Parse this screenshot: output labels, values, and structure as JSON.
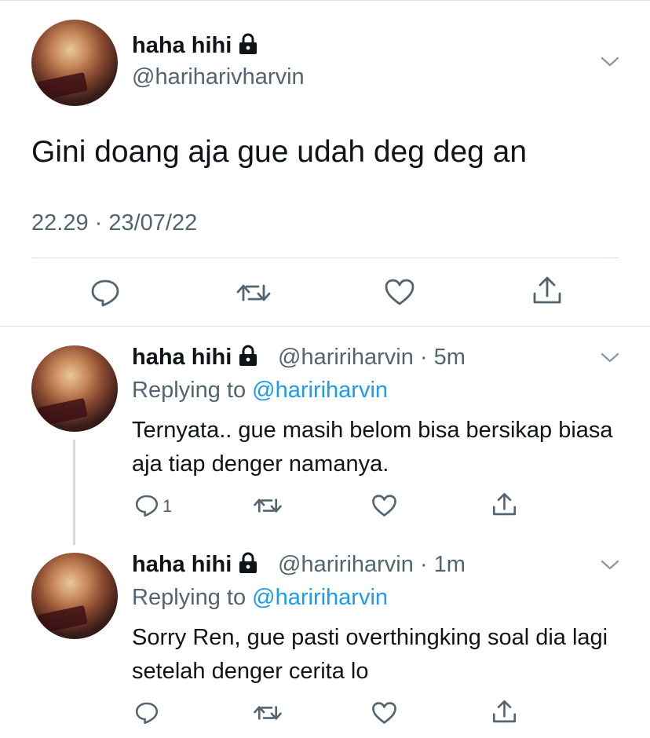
{
  "main_tweet": {
    "name": "haha hihi",
    "handle": "@hariharivharvin",
    "text": "Gini doang aja gue udah deg deg an",
    "timestamp": "22.29 · 23/07/22"
  },
  "replies": [
    {
      "name": "haha hihi",
      "handle": "@haririharvin",
      "time": "5m",
      "replying_label": "Replying to",
      "replying_handle": "@haririharvin",
      "text": "Ternyata.. gue masih belom bisa bersikap biasa aja tiap denger namanya.",
      "reply_count": "1"
    },
    {
      "name": "haha hihi",
      "handle": "@haririharvin",
      "time": "1m",
      "replying_label": "Replying to",
      "replying_handle": "@haririharvin",
      "text": "Sorry Ren, gue pasti overthingking soal dia lagi setelah denger cerita lo",
      "reply_count": ""
    }
  ],
  "icons": [
    "lock-icon",
    "chevron-down-icon",
    "reply-icon",
    "retweet-icon",
    "like-icon",
    "share-icon"
  ],
  "colors": {
    "text": "#0f1419",
    "muted": "#536471",
    "link": "#1d9bf0",
    "divider": "#d6dbdf"
  }
}
